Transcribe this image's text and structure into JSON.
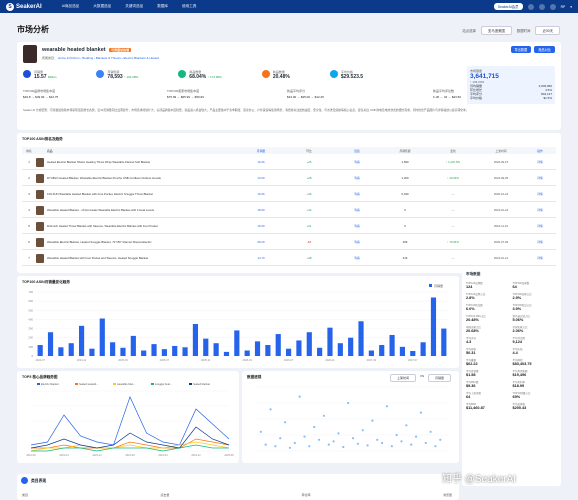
{
  "topbar": {
    "brand": "SeakerAI",
    "nav": [
      "Ai商品选品",
      "大数据选品",
      "关键词选品",
      "数据库",
      "使用工具"
    ],
    "badge": "SeakerAI会员",
    "user": "RP"
  },
  "page": {
    "title": "市场分析",
    "site_label": "站点选择",
    "site_value": "亚马逊美国",
    "period_label": "数据时间",
    "period_value": "近30天"
  },
  "product": {
    "name": "wearable heated blanket",
    "tag": "可穿戴加热毯",
    "meta_prefix": "所属类目",
    "meta_category": "Home & Kitchen › Bedding › Blankets & Throws › Electric Blankets & Heated",
    "export_btn": "导出数据",
    "compare_btn": "竞品对比",
    "metrics": [
      {
        "label": "月销量",
        "value": "15.57",
        "delta": "Million"
      },
      {
        "label": "月销售额",
        "value": "78,593",
        "delta": "↑ 104.28%"
      },
      {
        "label": "商品数量",
        "value": "68.04%",
        "delta": "↑ 172.95%"
      },
      {
        "label": "新品数量",
        "value": "20.48%",
        "delta": ""
      },
      {
        "label": "平均价格",
        "value": "$29.523.5",
        "delta": ""
      }
    ],
    "metrics2": [
      {
        "label": "TOP100品牌市场集中度",
        "value": "$49.8 → $49.09 → $42.75"
      },
      {
        "label": "TOP100卖家市场集中度",
        "value": "$75.99 → $65.99 → $59.99"
      },
      {
        "label": "新品平均评分",
        "value": "$33.00 → $25.00 → $12.25"
      },
      {
        "label": "新品平均评论数",
        "value": "F-30 → 43 → $23.50"
      }
    ],
    "side": {
      "label": "市场容量",
      "value": "3,641,715",
      "sub": "↑ 133.33%",
      "rows": [
        [
          "月均销量",
          "3,606,950"
        ],
        [
          "环比增长",
          "4.5%"
        ],
        [
          "平均评分",
          "804,137"
        ],
        [
          "平均价格",
          "$1.5%"
        ]
      ]
    },
    "description": "Seaker AI 分析结果：可穿戴加热毯市场呈现强劲增长态势，近30天销量同比显著提升，市场需求持续扩大。头部品牌集中度较低，新品进入机会较大。产品主要集中于冬季取暖、居家办公、户外露营等使用场景，消费者关注加热速度、安全性、可水洗及续航等核心卖点。建议关注 USB 供电及电池款式的细分需求，同时优化产品图片与详情描述以提高转化率。"
  },
  "top100": {
    "title": "TOP100 ASIN排名及趋势",
    "columns": [
      "排名",
      "商品",
      "月销量",
      "环比",
      "链接",
      "月销售额",
      "变化",
      "上架时间",
      "操作"
    ],
    "rows": [
      {
        "rank": "1",
        "title": "Heated Electric Blanket Shawl, Heating Throw Wrap Wearable Flannel Soft Blanket",
        "sales": "19.46",
        "chg": "+26",
        "link": "查看",
        "rev": "1,599",
        "chg2": "↑ 1,267.5%",
        "date": "2020-09-15",
        "act": "详情"
      },
      {
        "rank": "2",
        "title": "RYUBLO Heated Blanket, Wearable Electric Blanket Poncho USB Cordless Outdoor Hoodie",
        "sales": "13.09",
        "chg": "+28",
        "link": "查看",
        "rev": "1,209",
        "chg2": "↑ 43.63%",
        "date": "2023-09-05",
        "act": "详情"
      },
      {
        "rank": "3",
        "title": "KOLSUN Wearable Heated Blanket with Foot Pocket, Electric Snuggie Throw Blanket",
        "sales": "16.06",
        "chg": "+46",
        "link": "查看",
        "rev": "5,049",
        "chg2": "—",
        "date": "2020-10-24",
        "act": "详情"
      },
      {
        "rank": "4",
        "title": "Wearable Heated Blanket - 10 Hot Heats Wearable Electric Blanket with 4 Heat Levels",
        "sales": "18.09",
        "chg": "+44",
        "link": "查看",
        "rev": "0",
        "chg2": "—",
        "date": "2024-10-24",
        "act": "详情"
      },
      {
        "rank": "5",
        "title": "Ruhmich Heated Throw Blanket with Sleeves, Wearable Electric Blanket with Foot Pocket",
        "sales": "16.60",
        "chg": "+21",
        "link": "查看",
        "rev": "0",
        "chg2": "—",
        "date": "2024-11-16",
        "act": "详情"
      },
      {
        "rank": "6",
        "title": "Wearable Electric Blanket, Heated Snuggie Blanket, 72\"x50\" Flannel Sherpa Electric",
        "sales": "68.29",
        "chg": "-18",
        "link": "查看",
        "rev": "499",
        "chg2": "↑ 79.04%",
        "date": "2020-07-09",
        "act": "详情"
      },
      {
        "rank": "7",
        "title": "Wearable Heated Blanket with Foot Pocket and Sleeves, Heated Snuggie Blanket",
        "sales": "14.70",
        "chg": "+48",
        "link": "查看",
        "rev": "419",
        "chg2": "—",
        "date": "2024-10-21",
        "act": "详情"
      }
    ]
  },
  "sales_chart": {
    "title": "TOP100 ASIN月销量变化趋势",
    "legend": "月销量"
  },
  "trend_chart": {
    "title": "TOP5 核心品牌趋势图",
    "legend": [
      "Electric blanket",
      "heated wearab...",
      "wearable blan...",
      "snuggie heat...",
      "heated blanket"
    ]
  },
  "spread_chart": {
    "title": "数据透视",
    "tab1": "上架时间",
    "vs": "VS",
    "tab2": "月销量"
  },
  "market": {
    "title": "市场数据",
    "items": [
      [
        "TOP100品牌数",
        "124"
      ],
      [
        "TOP100卖家数",
        "64"
      ],
      [
        "TOP100品牌占比",
        "2.8%"
      ],
      [
        "TOP100卖家占比",
        "2.9%"
      ],
      [
        "TOP100新品数",
        "6.0%"
      ],
      [
        "TOP100新品占比",
        "3.9%"
      ],
      [
        "TOP100 FBA占比",
        "20.48%"
      ],
      [
        "亚马逊自营占比",
        "5.06%"
      ],
      [
        "中国卖家占比",
        "20.68%"
      ],
      [
        "美国卖家占比",
        "2.06%"
      ],
      [
        "平均评分",
        "4.3"
      ],
      [
        "平均评论数",
        "9,124"
      ],
      [
        "平均星级",
        "50.31"
      ],
      [
        "平均价格",
        "4.4"
      ],
      [
        "平均重量",
        "$62.22"
      ],
      [
        "平均体积",
        "$83,403.75"
      ],
      [
        "平均月销量",
        "$1.58"
      ],
      [
        "平均月销售额",
        "$19,496"
      ],
      [
        "平均FBA费",
        "$9.36"
      ],
      [
        "平均毛利率",
        "$18.99"
      ],
      [
        "平均上架天数",
        "64"
      ],
      [
        "TOP10销量占比",
        "69%"
      ],
      [
        "平均BSR",
        "$11,460.87"
      ],
      [
        "平均变体数",
        "$200.43"
      ]
    ]
  },
  "bottom": {
    "title": "类目表现",
    "cols": [
      "类目",
      "点击量",
      "转化率",
      "浏览量"
    ]
  },
  "watermark": "知乎 @SeakerAI",
  "chart_data": [
    {
      "type": "bar",
      "title": "TOP100 ASIN月销量变化趋势",
      "categories": [
        "2024-07",
        "2024-08",
        "2024-09",
        "2024-10",
        "2024-11",
        "2024-12",
        "2025-01",
        "2025-02",
        "2025-03",
        "2025-04",
        "2025-05",
        "2025-06",
        "2025-07",
        "2025-08",
        "2025-09",
        "2025-10",
        "2025-11",
        "2025-12",
        "2026-01",
        "2026-02",
        "2026-03",
        "2026-04",
        "2026-05",
        "2026-06",
        "2026-07",
        "2026-08",
        "2026-09",
        "2026-10",
        "2026-11",
        "2026-12",
        "2027-01",
        "2027-02",
        "2027-03",
        "2027-04",
        "2027-05",
        "2027-06",
        "2027-07",
        "2027-08",
        "2027-09",
        "2027-10"
      ],
      "values": [
        120,
        260,
        95,
        140,
        330,
        80,
        410,
        150,
        90,
        220,
        60,
        130,
        75,
        110,
        95,
        350,
        190,
        140,
        45,
        280,
        60,
        160,
        120,
        240,
        80,
        170,
        260,
        90,
        310,
        140,
        200,
        380,
        60,
        120,
        230,
        100,
        55,
        150,
        640,
        300
      ],
      "ylim": [
        0,
        700
      ]
    },
    {
      "type": "line",
      "title": "TOP5 核心品牌趋势图",
      "x": [
        "2021-08",
        "2021-12",
        "2022-04",
        "2022-08",
        "2022-12",
        "2023-04",
        "2023-08",
        "2023-12",
        "2024-04",
        "2024-08",
        "2024-12",
        "2025-04",
        "2025-08"
      ],
      "series": [
        {
          "name": "Electric blanket",
          "values": [
            2,
            3,
            12,
            5,
            3,
            2,
            18,
            6,
            3,
            2,
            14,
            9,
            4
          ]
        },
        {
          "name": "heated wearab...",
          "values": [
            1,
            1,
            2,
            1,
            1,
            1,
            3,
            2,
            1,
            1,
            4,
            3,
            2
          ]
        },
        {
          "name": "wearable blan...",
          "values": [
            0,
            1,
            1,
            2,
            1,
            1,
            2,
            1,
            1,
            2,
            3,
            2,
            1
          ]
        },
        {
          "name": "snuggie heat...",
          "values": [
            0,
            0,
            1,
            1,
            0,
            1,
            1,
            1,
            0,
            1,
            2,
            1,
            1
          ]
        },
        {
          "name": "heated blanket",
          "values": [
            1,
            2,
            4,
            2,
            1,
            2,
            6,
            3,
            2,
            1,
            8,
            4,
            2
          ]
        }
      ],
      "ylim": [
        0,
        20
      ]
    },
    {
      "type": "scatter",
      "title": "数据透视",
      "x": [
        0.1,
        0.2,
        0.3,
        0.4,
        0.5,
        0.6,
        0.7,
        0.8,
        0.9,
        1.0,
        1.1,
        1.2,
        1.3,
        1.4,
        1.5,
        1.6,
        1.7,
        1.8,
        1.9,
        2.0,
        2.1,
        2.2,
        2.3,
        2.4,
        2.5,
        2.6,
        2.7,
        2.8,
        2.9,
        3.0,
        3.1,
        3.2,
        3.3,
        3.4,
        3.5,
        3.6,
        3.7,
        3.8
      ],
      "y": [
        1200,
        400,
        2600,
        300,
        800,
        1800,
        200,
        500,
        3400,
        900,
        300,
        1500,
        700,
        2200,
        400,
        600,
        1100,
        250,
        3000,
        800,
        450,
        1300,
        350,
        1900,
        700,
        500,
        2800,
        300,
        1000,
        600,
        1600,
        400,
        900,
        2400,
        500,
        1200,
        300,
        700
      ],
      "ylim": [
        0,
        4000
      ]
    }
  ]
}
